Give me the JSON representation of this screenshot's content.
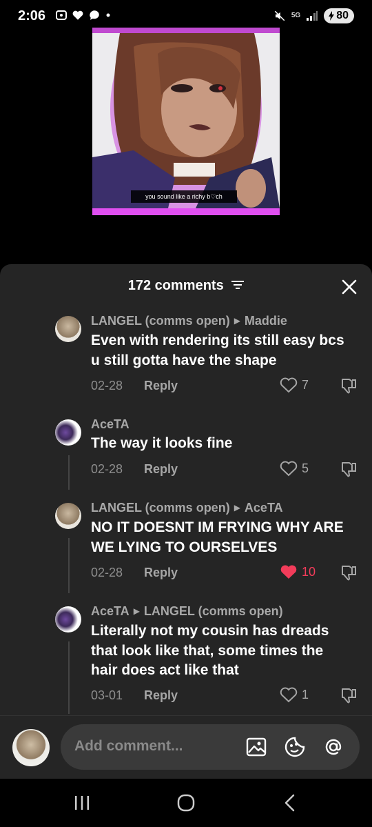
{
  "status": {
    "time": "2:06",
    "network": "5G",
    "battery": "80"
  },
  "video": {
    "caption": "you sound like a richy b♡ch"
  },
  "sheet": {
    "title": "172 comments"
  },
  "comments": [
    {
      "author": "LANGEL (comms open)",
      "reply_to": "Maddie",
      "text": "Even with rendering its still easy bcs u still gotta have the shape",
      "date": "02-28",
      "reply_label": "Reply",
      "likes": "7",
      "liked": false
    },
    {
      "author": "AceTA",
      "reply_to": "",
      "text": "The way it looks fine",
      "date": "02-28",
      "reply_label": "Reply",
      "likes": "5",
      "liked": false
    },
    {
      "author": "LANGEL (comms open)",
      "reply_to": "AceTA",
      "text": "NO IT DOESNT IM FRYING WHY ARE WE LYING TO OURSELVES",
      "date": "02-28",
      "reply_label": "Reply",
      "likes": "10",
      "liked": true
    },
    {
      "author": "AceTA",
      "reply_to": "LANGEL (comms open)",
      "text": "Literally not my cousin has dreads that look like that, some times the hair does act like that",
      "date": "03-01",
      "reply_label": "Reply",
      "likes": "1",
      "liked": false
    }
  ],
  "input": {
    "placeholder": "Add comment..."
  },
  "colors": {
    "sheet_bg": "#252525",
    "liked": "#f23c5a",
    "muted": "#a6a6a6"
  }
}
